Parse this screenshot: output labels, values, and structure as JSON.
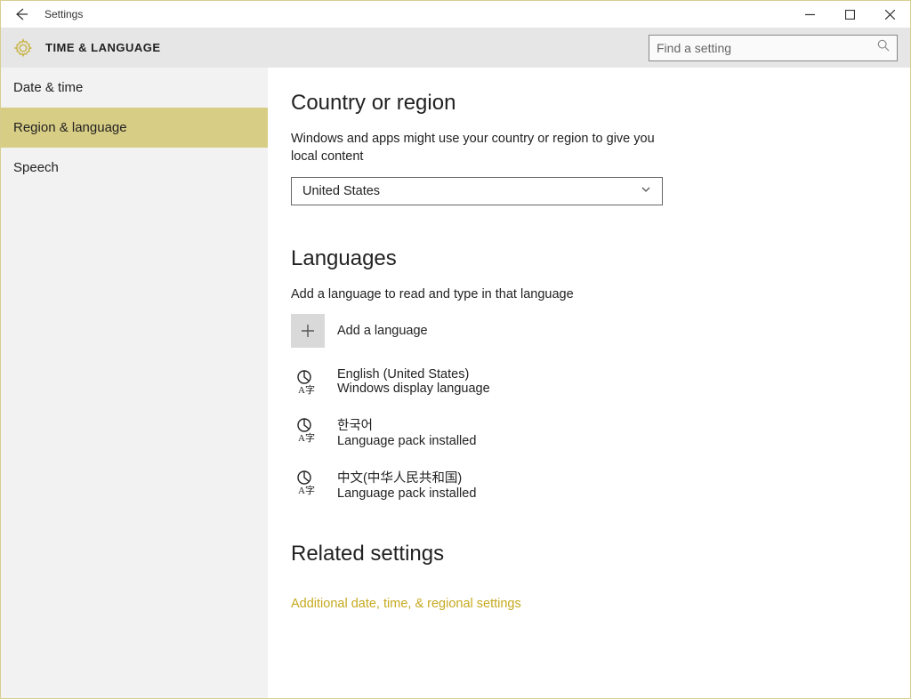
{
  "window": {
    "title": "Settings"
  },
  "header": {
    "section": "TIME & LANGUAGE",
    "search_placeholder": "Find a setting"
  },
  "sidebar": {
    "items": [
      {
        "label": "Date & time",
        "active": false
      },
      {
        "label": "Region & language",
        "active": true
      },
      {
        "label": "Speech",
        "active": false
      }
    ]
  },
  "main": {
    "country": {
      "heading": "Country or region",
      "blurb": "Windows and apps might use your country or region to give you local content",
      "selected": "United States"
    },
    "languages": {
      "heading": "Languages",
      "blurb": "Add a language to read and type in that language",
      "add_label": "Add a language",
      "list": [
        {
          "name": "English (United States)",
          "sub": "Windows display language"
        },
        {
          "name": "한국어",
          "sub": "Language pack installed"
        },
        {
          "name": "中文(中华人民共和国)",
          "sub": "Language pack installed"
        }
      ]
    },
    "related": {
      "heading": "Related settings",
      "link": "Additional date, time, & regional settings"
    }
  }
}
